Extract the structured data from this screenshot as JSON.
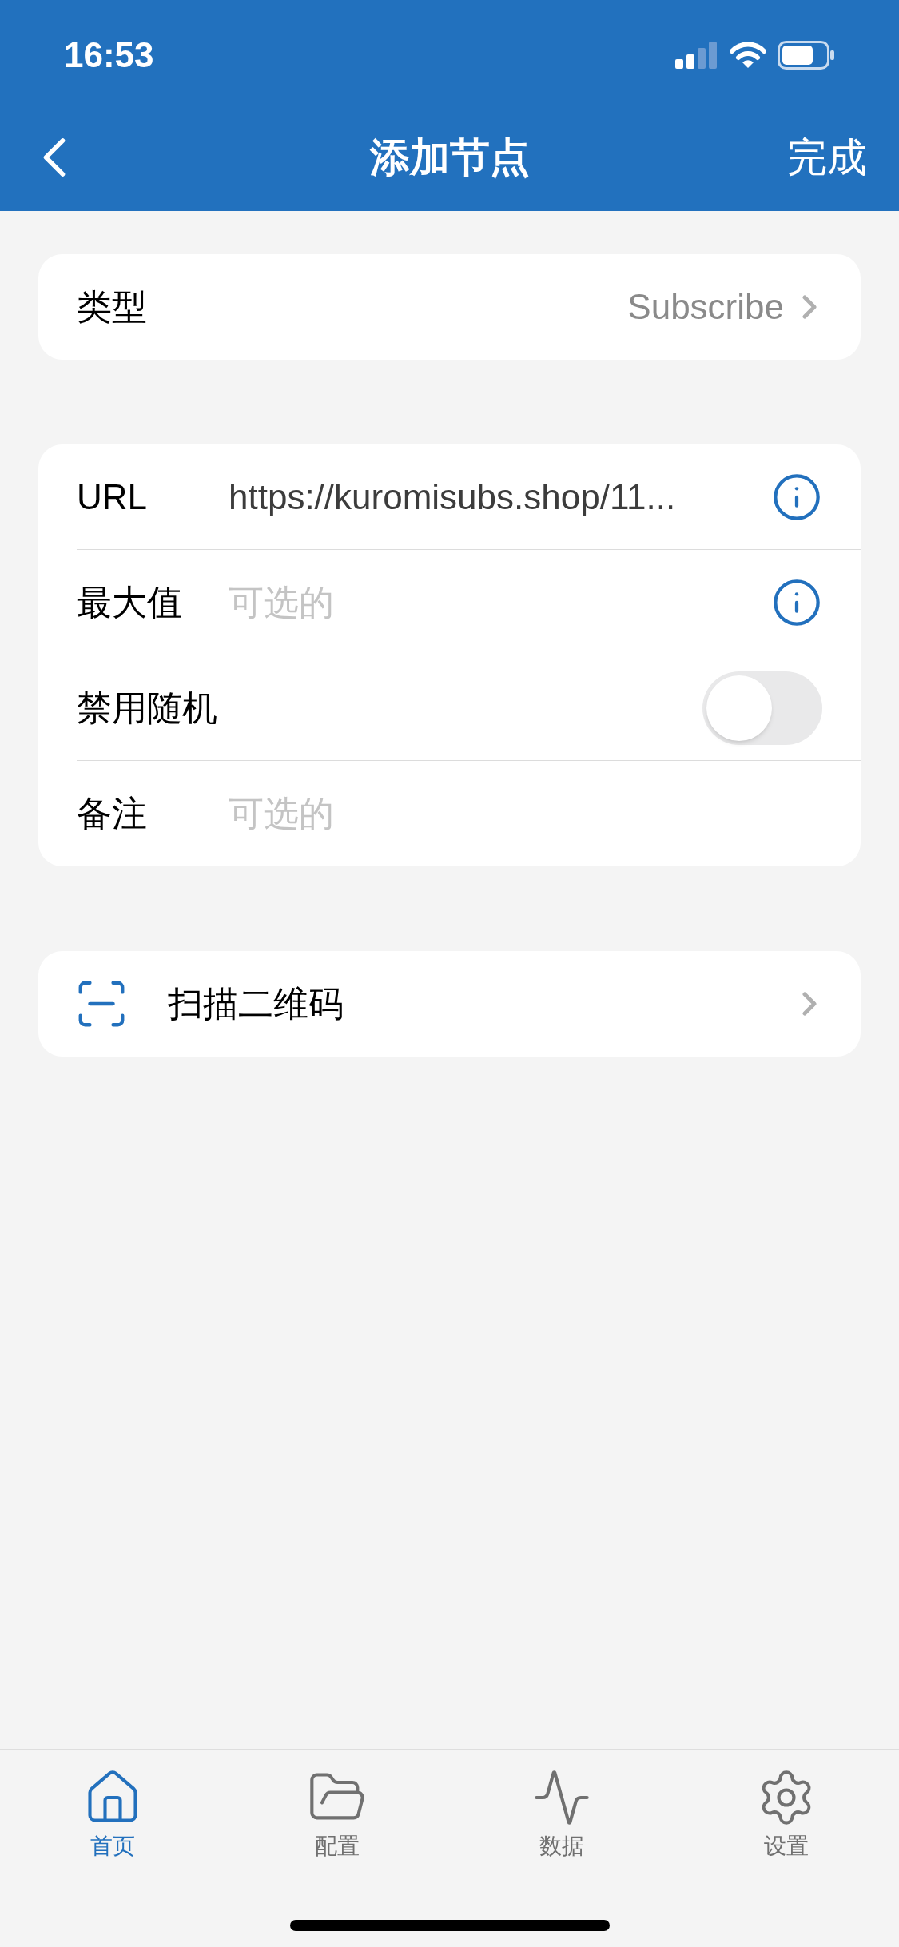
{
  "status_bar": {
    "time": "16:53"
  },
  "nav": {
    "title": "添加节点",
    "done": "完成"
  },
  "type_row": {
    "label": "类型",
    "value": "Subscribe"
  },
  "fields": [
    {
      "kind": "text",
      "label": "URL",
      "value": "https://kuromisubs.shop/11...",
      "info": true
    },
    {
      "kind": "text",
      "label": "最大值",
      "placeholder": "可选的",
      "info": true
    },
    {
      "kind": "toggle",
      "label": "禁用随机",
      "on": false
    },
    {
      "kind": "text",
      "label": "备注",
      "placeholder": "可选的",
      "info": false
    }
  ],
  "scan_row": {
    "label": "扫描二维码"
  },
  "tabs": [
    {
      "kind": "home",
      "label": "首页",
      "selected": true
    },
    {
      "kind": "folder",
      "label": "配置",
      "selected": false
    },
    {
      "kind": "pulse",
      "label": "数据",
      "selected": false
    },
    {
      "kind": "gear",
      "label": "设置",
      "selected": false
    }
  ]
}
